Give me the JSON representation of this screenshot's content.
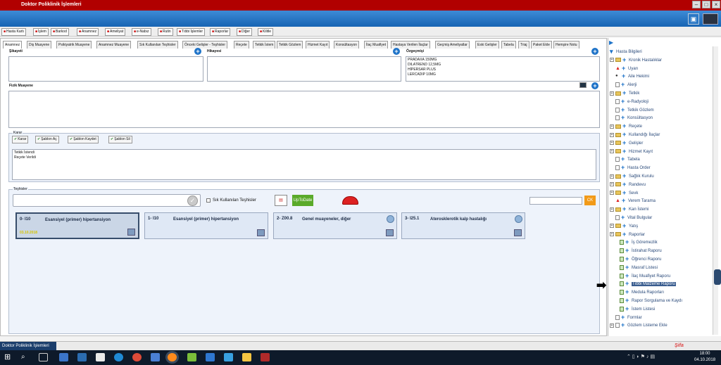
{
  "window": {
    "title": "Doktor Poliklinik İşlemleri",
    "status_label": "Doktor Poliklinik İşlemleri"
  },
  "toolbar": [
    {
      "label": "Hasta Kartı",
      "icon": "card-icon"
    },
    {
      "label": "İşlem",
      "icon": "process-icon"
    },
    {
      "label": "Barkod",
      "icon": "barcode-icon"
    },
    {
      "label": "Anamnez",
      "icon": "anamnez-icon"
    },
    {
      "label": "Ameliyat",
      "icon": "surgery-icon"
    },
    {
      "label": "e-Nabız",
      "icon": "enabiz-icon"
    },
    {
      "label": "Rutin",
      "icon": "routine-icon"
    },
    {
      "label": "Tıbbi İşlemler",
      "icon": "medical-icon"
    },
    {
      "label": "Raporlar",
      "icon": "report-icon"
    },
    {
      "label": "Diğer",
      "icon": "other-icon"
    },
    {
      "label": "Kilitle",
      "icon": "lock-icon"
    }
  ],
  "tabs": [
    {
      "label": "Anamnez",
      "active": true
    },
    {
      "label": "Diş Muayene"
    },
    {
      "label": "Psikiyatrik Muayene"
    },
    {
      "label": "Anamnez Muayene"
    },
    {
      "label": "Sık Kullanılan Teşhisler"
    },
    {
      "label": "Önceki Gelişler - Teşhisler"
    },
    {
      "label": "Reçete"
    },
    {
      "label": "Tetkik İstem"
    },
    {
      "label": "Tetkik Gözlem"
    },
    {
      "label": "Hizmet Kayıt"
    },
    {
      "label": "Konsültasyon"
    },
    {
      "label": "İlaç Muafiyet"
    },
    {
      "label": "Hastaya Verilen İlaçlar"
    },
    {
      "label": "Geçmiş Ameliyatlar"
    },
    {
      "label": "Eski Gelişler"
    },
    {
      "label": "Tabela"
    },
    {
      "label": "Triaj"
    },
    {
      "label": "Paket Ekle"
    },
    {
      "label": "Hemşire Notu"
    }
  ],
  "anamnez": {
    "sikayet_label": "Şikayeti",
    "hikaye_label": "Hikayesi",
    "ozgecmis_label": "Özgeçmişi",
    "ozgecmis_lines": [
      "PRADAXA 150MG",
      "DILATREND 12,5MG",
      "HİPERSAR PLUS",
      "LERCADIP 10MG"
    ],
    "fizik_label": "Fizik Muayene"
  },
  "karar": {
    "legend": "Karar",
    "buttons": [
      "Karar",
      "Şablon Aç",
      "Şablon Kaydet",
      "Şablon Sil"
    ],
    "lines": [
      "Tetkik İstendi",
      "Reçete Verildi"
    ]
  },
  "teshisler": {
    "legend": "Teşhisler",
    "sik_kullanilan": "Sık Kullanılan Teşhisler",
    "uptodate": "UpToDate",
    "search_button": "CK",
    "cards": [
      {
        "prefix": "0- I10",
        "name": "Esansiyel (primer) hipertansiyon",
        "date": "03.10.2018"
      },
      {
        "prefix": "1- I10",
        "name": "Esansiyel (primer) hipertansiyon",
        "date": ""
      },
      {
        "prefix": "2- Z00.8",
        "name": "Genel muayeneler, diğer",
        "date": ""
      },
      {
        "prefix": "3- I25.1",
        "name": "Aterosklerotik kalp hastalığı",
        "date": ""
      }
    ]
  },
  "tree": [
    {
      "label": "Hasta Bilgileri",
      "level": 0,
      "type": "root"
    },
    {
      "label": "Kronik Hastalıklar",
      "level": 1,
      "type": "folder-plus"
    },
    {
      "label": "Uyarı",
      "level": 1,
      "type": "warn"
    },
    {
      "label": "Aile Hekimi",
      "level": 1,
      "type": "person"
    },
    {
      "label": "Alerji",
      "level": 1,
      "type": "plain"
    },
    {
      "label": "Tetkik",
      "level": 1,
      "type": "folder-plus"
    },
    {
      "label": "e-Radyoloji",
      "level": 1,
      "type": "plain"
    },
    {
      "label": "Tetkik Gözlem",
      "level": 1,
      "type": "plain"
    },
    {
      "label": "Konsültasyon",
      "level": 1,
      "type": "doc"
    },
    {
      "label": "Reçete",
      "level": 1,
      "type": "folder-plus"
    },
    {
      "label": "Kullandığı İlaçlar",
      "level": 1,
      "type": "folder-plus"
    },
    {
      "label": "Gelişler",
      "level": 1,
      "type": "folder-plain"
    },
    {
      "label": "Hizmet Kayıt",
      "level": 1,
      "type": "folder-plus"
    },
    {
      "label": "Tabela",
      "level": 1,
      "type": "plain"
    },
    {
      "label": "Hasta Order",
      "level": 1,
      "type": "doc"
    },
    {
      "label": "Sağlık Kurulu",
      "level": 1,
      "type": "folder-plus"
    },
    {
      "label": "Randevu",
      "level": 1,
      "type": "folder-plus"
    },
    {
      "label": "Sevk",
      "level": 1,
      "type": "folder-plain"
    },
    {
      "label": "Verem Tarama",
      "level": 1,
      "type": "warn"
    },
    {
      "label": "Kan İstemi",
      "level": 1,
      "type": "folder-plus"
    },
    {
      "label": "Vital Bulgular",
      "level": 1,
      "type": "plain"
    },
    {
      "label": "Yatış",
      "level": 1,
      "type": "folder-plain"
    },
    {
      "label": "Raporlar",
      "level": 1,
      "type": "folder-plain"
    },
    {
      "label": "İş Göremezlik",
      "level": 2,
      "type": "gdoc-plus"
    },
    {
      "label": "İstirahat Raporu",
      "level": 2,
      "type": "gdoc"
    },
    {
      "label": "Öğrenci Raporu",
      "level": 2,
      "type": "gdoc"
    },
    {
      "label": "Masraf Listesi",
      "level": 2,
      "type": "gdoc"
    },
    {
      "label": "İlaç Muafiyet Raporu",
      "level": 2,
      "type": "gdoc"
    },
    {
      "label": "Tıbbi Malzeme Raporu",
      "level": 2,
      "type": "gdoc",
      "highlight": true
    },
    {
      "label": "Medula Raporları",
      "level": 2,
      "type": "gdoc"
    },
    {
      "label": "Rapor Sorgulama ve Kaydı",
      "level": 2,
      "type": "gdoc-plus"
    },
    {
      "label": "İstem Listesi",
      "level": 2,
      "type": "gdoc-plus"
    },
    {
      "label": "Formlar",
      "level": 1,
      "type": "plain"
    },
    {
      "label": "Gözlem Listeme Ekle",
      "level": 1,
      "type": "doc-plus"
    }
  ],
  "clock": {
    "time": "18:00",
    "date": "04.10.2018"
  },
  "colors": {
    "titlebar": "#b10000",
    "banner": "#1764b3",
    "accent": "#1e73c8",
    "highlight": "#3a5d8f"
  }
}
